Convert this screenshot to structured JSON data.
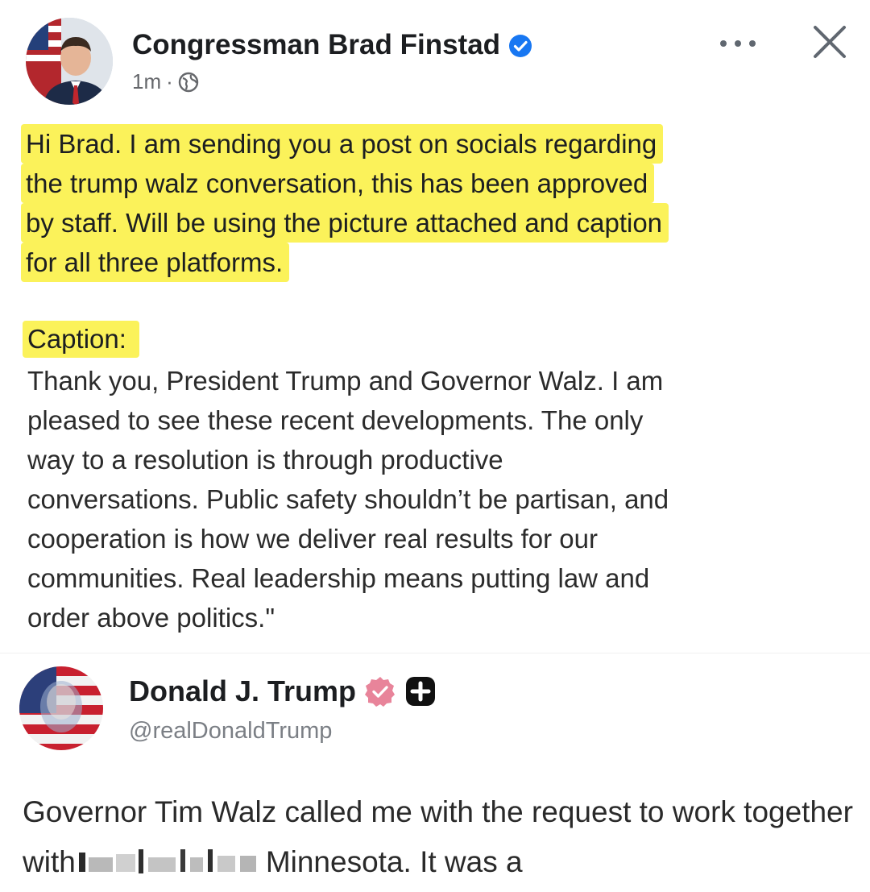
{
  "post": {
    "author": "Congressman Brad Finstad",
    "time": "1m",
    "separator": "·",
    "message_lines": [
      "Hi Brad. I am sending you a post on socials regarding",
      "the trump walz conversation, this has been approved",
      "by staff. Will be using the picture attached and caption",
      "for all three platforms."
    ],
    "caption_label": "Caption:",
    "caption_text": "Thank you, President Trump and Governor Walz. I am\npleased to see these recent developments. The only\nway to a resolution is through productive\nconversations. Public safety shouldn’t be partisan, and\ncooperation is how we deliver real results for our\ncommunities. Real leadership means putting law and\norder above politics.\""
  },
  "embed": {
    "name": "Donald J. Trump",
    "handle": "@realDonaldTrump",
    "body_start": "Governor Tim Walz called me with the request to work together with",
    "body_end": "Minnesota. It was a"
  },
  "colors": {
    "highlight": "#fbf25a",
    "verified_blue": "#1877f2",
    "badge_pink": "#e8849a"
  },
  "icons": {
    "verified": "verified-badge-icon",
    "audience": "globe-icon",
    "more": "more-dots-icon",
    "close": "close-icon",
    "truth_badge": "pink-verified-icon",
    "plus": "plus-badge-icon"
  }
}
